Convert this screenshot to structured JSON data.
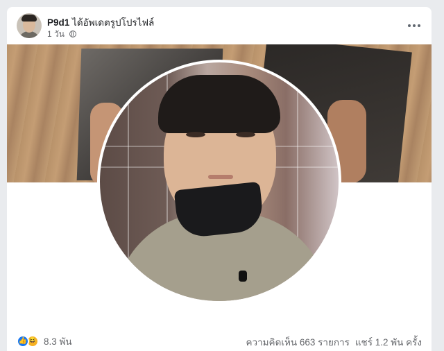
{
  "post": {
    "author_name": "P9d1",
    "action_text": "ได้อัพเดตรูปโปรไฟล์",
    "timestamp": "1 วัน"
  },
  "icons": {
    "more": "more-options-icon",
    "privacy": "globe-icon",
    "like": "like-reaction-icon",
    "haha": "haha-reaction-icon"
  },
  "footer": {
    "reactions_count": "8.3 พัน",
    "comments": "ความคิดเห็น 663 รายการ",
    "shares": "แชร์ 1.2 พัน ครั้ง"
  },
  "colors": {
    "like_blue": "#1877f2",
    "haha_yellow": "#f7b125",
    "secondary_text": "#65676b"
  }
}
